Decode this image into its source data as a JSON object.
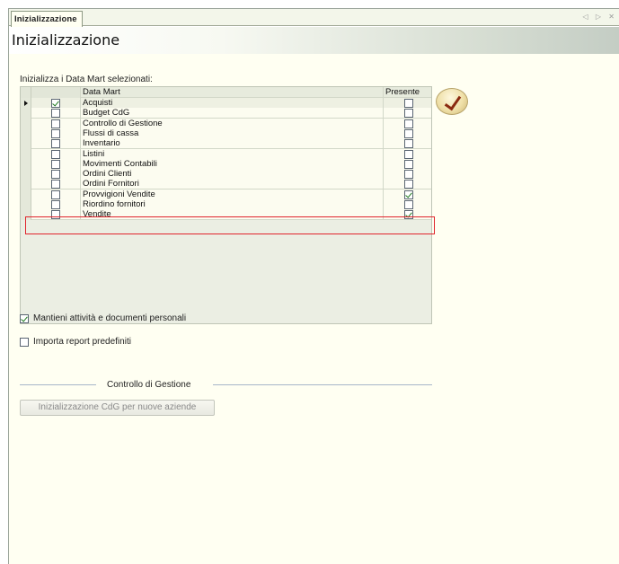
{
  "tab": {
    "label": "Inizializzazione",
    "nav_glyphs": "◁ ▷ ✕"
  },
  "page": {
    "title": "Inizializzazione"
  },
  "section": {
    "label": "Inizializza i Data Mart selezionati:"
  },
  "grid": {
    "columns": [
      "Data Mart",
      "Presente"
    ],
    "rows": [
      {
        "name": "Acquisti",
        "selected": true,
        "presente": false,
        "current": true
      },
      {
        "name": "Budget CdG",
        "selected": false,
        "presente": false
      },
      {
        "name": "Controllo di Gestione",
        "selected": false,
        "presente": false
      },
      {
        "name": "Flussi di cassa",
        "selected": false,
        "presente": false
      },
      {
        "name": "Inventario",
        "selected": false,
        "presente": false
      },
      {
        "name": "Listini",
        "selected": false,
        "presente": false
      },
      {
        "name": "Movimenti Contabili",
        "selected": false,
        "presente": false
      },
      {
        "name": "Ordini Clienti",
        "selected": false,
        "presente": false
      },
      {
        "name": "Ordini Fornitori",
        "selected": false,
        "presente": false
      },
      {
        "name": "Provvigioni Vendite",
        "selected": false,
        "presente": true,
        "highlighted": true
      },
      {
        "name": "Riordino fornitori",
        "selected": false,
        "presente": false
      },
      {
        "name": "Vendite",
        "selected": false,
        "presente": true
      }
    ]
  },
  "options": {
    "keep_personal": {
      "label": "Mantieni attività e documenti personali",
      "checked": true
    },
    "import_reports": {
      "label": "Importa report predefiniti",
      "checked": false
    }
  },
  "group": {
    "title": "Controllo di Gestione"
  },
  "buttons": {
    "cdg_init": "Inizializzazione CdG per nuove aziende"
  },
  "colors": {
    "highlight": "#e0242c",
    "background": "#fffff2",
    "accent_check": "#1f7a1f"
  }
}
